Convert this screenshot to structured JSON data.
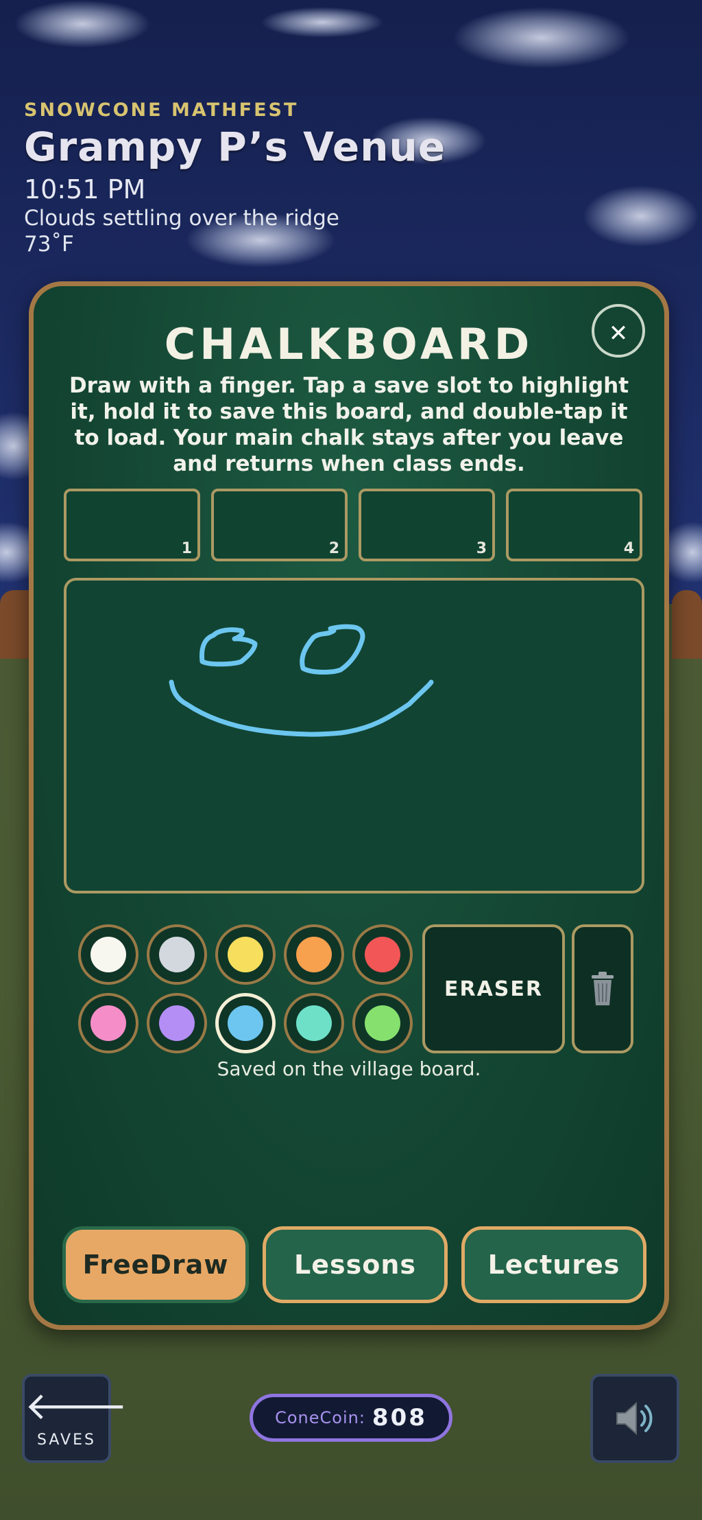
{
  "hud": {
    "event": "SNOWCONE MATHFEST",
    "venue": "Grampy P’s Venue",
    "time": "10:51 PM",
    "weather": "Clouds settling over the ridge",
    "temperature": "73˚F"
  },
  "panel": {
    "title": "CHALKBOARD",
    "close_label": "✕",
    "instructions": "Draw with a finger. Tap a save slot to highlight it, hold it to save this board, and double-tap it to load. Your main chalk stays after you leave and returns when class ends.",
    "slots": [
      "1",
      "2",
      "3",
      "4"
    ],
    "palette": {
      "colors": [
        "#f7f7f0",
        "#d3d7de",
        "#f7de5c",
        "#f7a04e",
        "#f25656",
        "#f58ec8",
        "#b48ef5",
        "#6cc6ef",
        "#6ee0c8",
        "#86e06e"
      ],
      "selected_color": "#6cc6ef",
      "stroke_color": "#6cc6ef"
    },
    "eraser_label": "ERASER",
    "trash_icon": "trash-icon",
    "status": "Saved on the village board.",
    "tabs": [
      "FreeDraw",
      "Lessons",
      "Lectures"
    ],
    "active_tab": "FreeDraw"
  },
  "footer": {
    "back_label": "SAVES",
    "coin_label": "ConeCoin:",
    "coin_value": "808",
    "sound_icon": "speaker-icon"
  },
  "colors": {
    "panel_border": "#a47844",
    "panel_bg": "#134532",
    "accent_orange": "#e8a865",
    "coin_border": "#8f75e0"
  }
}
